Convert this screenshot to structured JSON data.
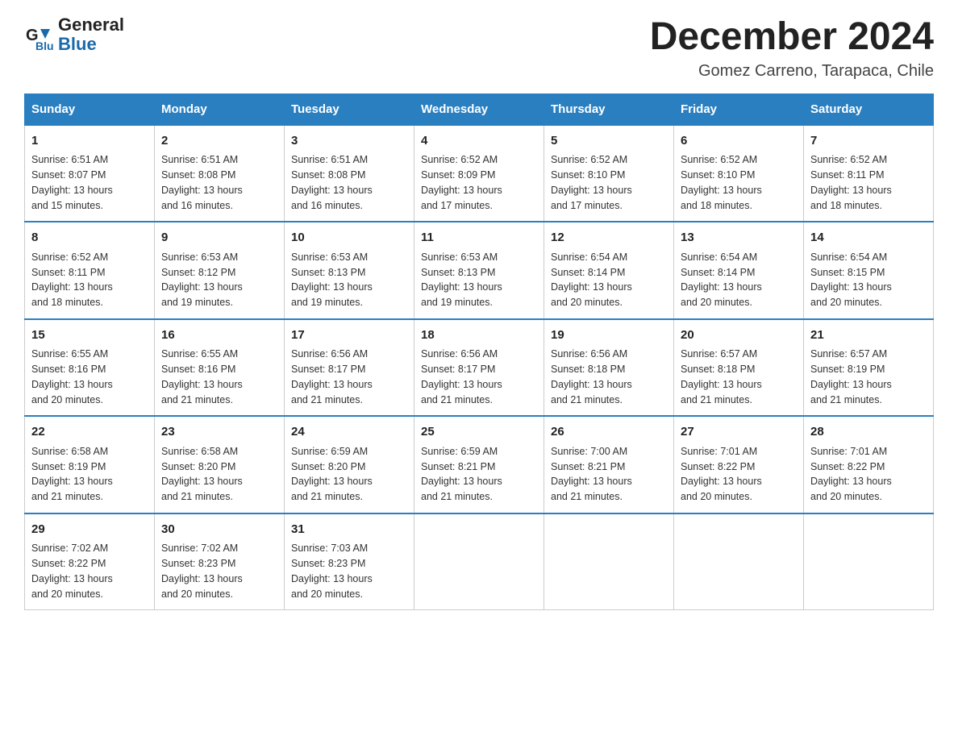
{
  "logo": {
    "text_general": "General",
    "text_blue": "Blue"
  },
  "title": "December 2024",
  "subtitle": "Gomez Carreno, Tarapaca, Chile",
  "days_of_week": [
    "Sunday",
    "Monday",
    "Tuesday",
    "Wednesday",
    "Thursday",
    "Friday",
    "Saturday"
  ],
  "weeks": [
    [
      {
        "day": "1",
        "sunrise": "6:51 AM",
        "sunset": "8:07 PM",
        "daylight": "13 hours and 15 minutes."
      },
      {
        "day": "2",
        "sunrise": "6:51 AM",
        "sunset": "8:08 PM",
        "daylight": "13 hours and 16 minutes."
      },
      {
        "day": "3",
        "sunrise": "6:51 AM",
        "sunset": "8:08 PM",
        "daylight": "13 hours and 16 minutes."
      },
      {
        "day": "4",
        "sunrise": "6:52 AM",
        "sunset": "8:09 PM",
        "daylight": "13 hours and 17 minutes."
      },
      {
        "day": "5",
        "sunrise": "6:52 AM",
        "sunset": "8:10 PM",
        "daylight": "13 hours and 17 minutes."
      },
      {
        "day": "6",
        "sunrise": "6:52 AM",
        "sunset": "8:10 PM",
        "daylight": "13 hours and 18 minutes."
      },
      {
        "day": "7",
        "sunrise": "6:52 AM",
        "sunset": "8:11 PM",
        "daylight": "13 hours and 18 minutes."
      }
    ],
    [
      {
        "day": "8",
        "sunrise": "6:52 AM",
        "sunset": "8:11 PM",
        "daylight": "13 hours and 18 minutes."
      },
      {
        "day": "9",
        "sunrise": "6:53 AM",
        "sunset": "8:12 PM",
        "daylight": "13 hours and 19 minutes."
      },
      {
        "day": "10",
        "sunrise": "6:53 AM",
        "sunset": "8:13 PM",
        "daylight": "13 hours and 19 minutes."
      },
      {
        "day": "11",
        "sunrise": "6:53 AM",
        "sunset": "8:13 PM",
        "daylight": "13 hours and 19 minutes."
      },
      {
        "day": "12",
        "sunrise": "6:54 AM",
        "sunset": "8:14 PM",
        "daylight": "13 hours and 20 minutes."
      },
      {
        "day": "13",
        "sunrise": "6:54 AM",
        "sunset": "8:14 PM",
        "daylight": "13 hours and 20 minutes."
      },
      {
        "day": "14",
        "sunrise": "6:54 AM",
        "sunset": "8:15 PM",
        "daylight": "13 hours and 20 minutes."
      }
    ],
    [
      {
        "day": "15",
        "sunrise": "6:55 AM",
        "sunset": "8:16 PM",
        "daylight": "13 hours and 20 minutes."
      },
      {
        "day": "16",
        "sunrise": "6:55 AM",
        "sunset": "8:16 PM",
        "daylight": "13 hours and 21 minutes."
      },
      {
        "day": "17",
        "sunrise": "6:56 AM",
        "sunset": "8:17 PM",
        "daylight": "13 hours and 21 minutes."
      },
      {
        "day": "18",
        "sunrise": "6:56 AM",
        "sunset": "8:17 PM",
        "daylight": "13 hours and 21 minutes."
      },
      {
        "day": "19",
        "sunrise": "6:56 AM",
        "sunset": "8:18 PM",
        "daylight": "13 hours and 21 minutes."
      },
      {
        "day": "20",
        "sunrise": "6:57 AM",
        "sunset": "8:18 PM",
        "daylight": "13 hours and 21 minutes."
      },
      {
        "day": "21",
        "sunrise": "6:57 AM",
        "sunset": "8:19 PM",
        "daylight": "13 hours and 21 minutes."
      }
    ],
    [
      {
        "day": "22",
        "sunrise": "6:58 AM",
        "sunset": "8:19 PM",
        "daylight": "13 hours and 21 minutes."
      },
      {
        "day": "23",
        "sunrise": "6:58 AM",
        "sunset": "8:20 PM",
        "daylight": "13 hours and 21 minutes."
      },
      {
        "day": "24",
        "sunrise": "6:59 AM",
        "sunset": "8:20 PM",
        "daylight": "13 hours and 21 minutes."
      },
      {
        "day": "25",
        "sunrise": "6:59 AM",
        "sunset": "8:21 PM",
        "daylight": "13 hours and 21 minutes."
      },
      {
        "day": "26",
        "sunrise": "7:00 AM",
        "sunset": "8:21 PM",
        "daylight": "13 hours and 21 minutes."
      },
      {
        "day": "27",
        "sunrise": "7:01 AM",
        "sunset": "8:22 PM",
        "daylight": "13 hours and 20 minutes."
      },
      {
        "day": "28",
        "sunrise": "7:01 AM",
        "sunset": "8:22 PM",
        "daylight": "13 hours and 20 minutes."
      }
    ],
    [
      {
        "day": "29",
        "sunrise": "7:02 AM",
        "sunset": "8:22 PM",
        "daylight": "13 hours and 20 minutes."
      },
      {
        "day": "30",
        "sunrise": "7:02 AM",
        "sunset": "8:23 PM",
        "daylight": "13 hours and 20 minutes."
      },
      {
        "day": "31",
        "sunrise": "7:03 AM",
        "sunset": "8:23 PM",
        "daylight": "13 hours and 20 minutes."
      },
      null,
      null,
      null,
      null
    ]
  ]
}
